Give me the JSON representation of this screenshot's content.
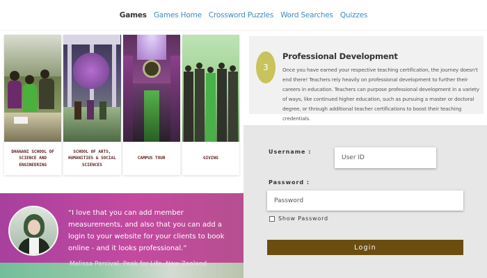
{
  "nav": {
    "items": [
      "Games",
      "Games Home",
      "Crossword Puzzles",
      "Word Searches",
      "Quizzes"
    ],
    "active": "Games",
    "link_color": "#3e8eb7"
  },
  "tiles": [
    {
      "caption": "DHANANI SCHOOL OF SCIENCE AND ENGINEERING"
    },
    {
      "caption": "SCHOOL OF ARTS, HUMANITIES & SOCIAL SCIENCES"
    },
    {
      "caption": "CAMPUS TOUR"
    },
    {
      "caption": "GIVING"
    }
  ],
  "testimonial": {
    "quote": "“I love that you can add member measurements, and also that you can add a login to your website for your clients to book online - and it looks professional.”",
    "author": "Melissa Percival, Peak for Life, New Zealand"
  },
  "professional_development": {
    "number": "3",
    "title": "Professional Development",
    "text": "Once you have earned your respective teaching certification, the journey doesn't end there! Teachers rely heavily on professional development to further their careers in education. Teachers can purpose professional development in a variety of ways, like continued higher education, such as pursuing a master or doctoral degree, or through additional teacher certifications to boost their teaching credentials.",
    "badge_color": "#c8c35a"
  },
  "login": {
    "username_label": "Username :",
    "username_placeholder": "User ID",
    "password_label": "Password :",
    "password_placeholder": "Password",
    "show_password": "Show Password",
    "button": "Login",
    "button_color": "#6b4d0f"
  }
}
